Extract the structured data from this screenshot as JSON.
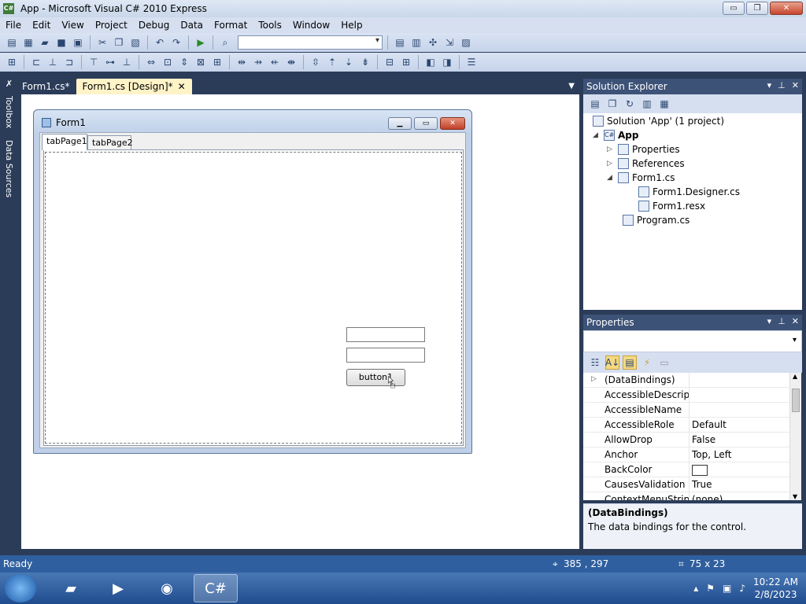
{
  "window": {
    "title": "App - Microsoft Visual C# 2010 Express",
    "icon": "csharp-app-icon",
    "minimize": "▭",
    "maximize": "❐",
    "close": "✕"
  },
  "menu": [
    "File",
    "Edit",
    "View",
    "Project",
    "Debug",
    "Data",
    "Format",
    "Tools",
    "Window",
    "Help"
  ],
  "sidetabs": {
    "toolbox": "Toolbox",
    "datasources": "Data Sources"
  },
  "doctabs": [
    {
      "label": "Form1.cs*"
    },
    {
      "label": "Form1.cs [Design]*",
      "close": "✕"
    }
  ],
  "form": {
    "title": "Form1",
    "tabs": [
      "tabPage1",
      "tabPage2"
    ],
    "button_label": "button1"
  },
  "solution_explorer": {
    "title": "Solution Explorer",
    "items": [
      {
        "label": "Solution 'App' (1 project)"
      },
      {
        "label": "App"
      },
      {
        "label": "Properties"
      },
      {
        "label": "References"
      },
      {
        "label": "Form1.cs"
      },
      {
        "label": "Form1.Designer.cs"
      },
      {
        "label": "Form1.resx"
      },
      {
        "label": "Program.cs"
      }
    ]
  },
  "properties": {
    "title": "Properties",
    "rows": [
      {
        "name": "(DataBindings)",
        "value": ""
      },
      {
        "name": "AccessibleDescriptic",
        "value": ""
      },
      {
        "name": "AccessibleName",
        "value": ""
      },
      {
        "name": "AccessibleRole",
        "value": "Default"
      },
      {
        "name": "AllowDrop",
        "value": "False"
      },
      {
        "name": "Anchor",
        "value": "Top, Left"
      },
      {
        "name": "BackColor",
        "value": ""
      },
      {
        "name": "CausesValidation",
        "value": "True"
      },
      {
        "name": "ContextMenuStrip",
        "value": "(none)"
      }
    ],
    "desc_title": "(DataBindings)",
    "desc_text": "The data bindings for the control."
  },
  "status": {
    "text": "Ready",
    "position": "385 , 297",
    "size": "75 x 23"
  },
  "taskbar": {
    "time": "10:22 AM",
    "date": "2/8/2023"
  }
}
